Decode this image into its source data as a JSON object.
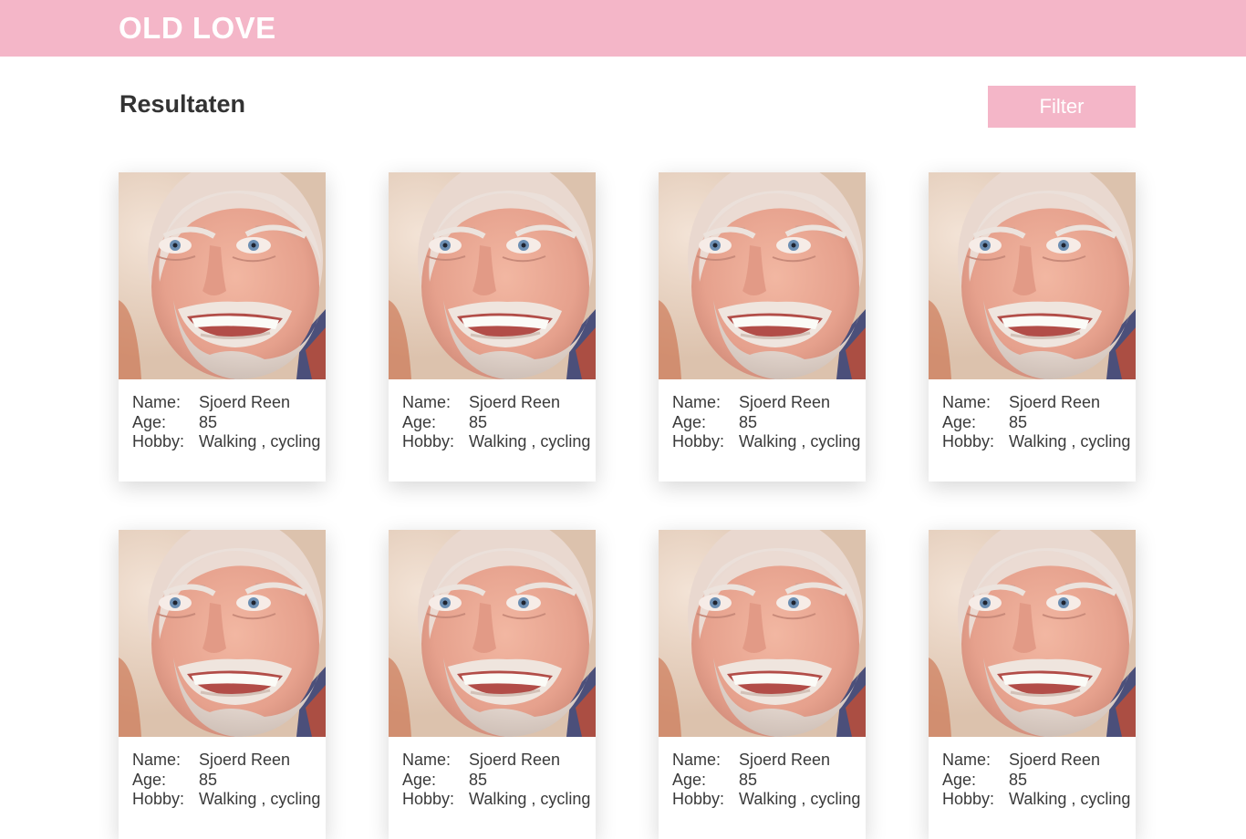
{
  "header": {
    "brand": "OLD LOVE",
    "background_color": "#f4b6c8"
  },
  "main": {
    "title": "Resultaten",
    "filter_label": "Filter"
  },
  "labels": {
    "name": "Name:",
    "age": "Age:",
    "hobby": "Hobby:"
  },
  "profiles": [
    {
      "name": "Sjoerd Reen",
      "age": "85",
      "hobby": "Walking , cycling",
      "photo": "smiling-old-man-photo"
    },
    {
      "name": "Sjoerd Reen",
      "age": "85",
      "hobby": "Walking , cycling",
      "photo": "smiling-old-man-photo"
    },
    {
      "name": "Sjoerd Reen",
      "age": "85",
      "hobby": "Walking , cycling",
      "photo": "smiling-old-man-photo"
    },
    {
      "name": "Sjoerd Reen",
      "age": "85",
      "hobby": "Walking , cycling",
      "photo": "smiling-old-man-photo"
    },
    {
      "name": "Sjoerd Reen",
      "age": "85",
      "hobby": "Walking , cycling",
      "photo": "smiling-old-man-photo"
    },
    {
      "name": "Sjoerd Reen",
      "age": "85",
      "hobby": "Walking , cycling",
      "photo": "smiling-old-man-photo"
    },
    {
      "name": "Sjoerd Reen",
      "age": "85",
      "hobby": "Walking , cycling",
      "photo": "smiling-old-man-photo"
    },
    {
      "name": "Sjoerd Reen",
      "age": "85",
      "hobby": "Walking , cycling",
      "photo": "smiling-old-man-photo"
    }
  ]
}
